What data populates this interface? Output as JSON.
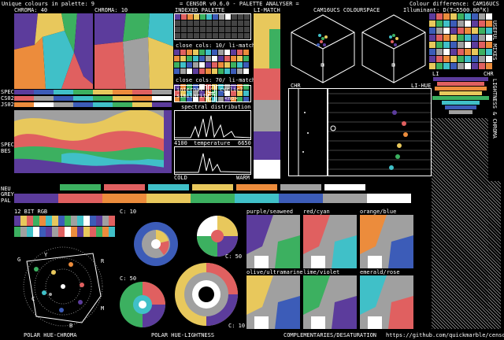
{
  "header": {
    "unique": "Unique colours in palette: 9",
    "title": "= CENSOR v0.6.0 - PALETTE ANALYSER =",
    "colour_diff": "Colour difference: CAM16UCS",
    "illuminant": "Illuminant: D(T=5500.00°K)"
  },
  "labels": {
    "chroma40": "CHROMA: 40",
    "chroma10": "CHROMA: 10",
    "indexed": "INDEXED PALETTE",
    "li_match": "LI-MATCH",
    "cam": "CAM16UCS COLOURSPACE",
    "spec": "SPEC",
    "cs02": "CS02",
    "js02": "JS02",
    "spec2": "SPEC",
    "bes": "BES",
    "neu": "NEU",
    "grey": "GREY",
    "pal": "PAL",
    "bit12": "12 BIT RGB",
    "close1": "close cols: 10/ li-match",
    "close2": "close cols: 70/ li-match",
    "internal": "internal",
    "similarity": "similarity",
    "cyclic": "cyclic?",
    "no": "<no>",
    "spectral": "spectral distribution",
    "k4100": "4100",
    "k6650": "6650",
    "temperature": "temperature",
    "cold": "COLD",
    "warm": "WARM",
    "chr": "CHR",
    "li_hue": "LI-HUE",
    "li": "LI",
    "chr2": "CHR",
    "useful": "USEFUL MIXES",
    "lightness_chroma": "LIGHTNESS & CHROMA",
    "polar_hc": "POLAR HUE-CHROMA",
    "polar_hl": "POLAR HUE-LIGHTNESS",
    "compl": "COMPLEMENTARIES/DESATURATION",
    "url": "https://github.com/quickmarble/censor",
    "c10a": "C: 10",
    "c50a": "C: 50",
    "c50b": "C: 50",
    "c10b": "C: 10",
    "pair1": "purple/seaweed",
    "pair2": "red/cyan",
    "pair3": "orange/blue",
    "pair4": "olive/ultramarine",
    "pair5": "lime/violet",
    "pair6": "emerald/rose",
    "hc_g": "G",
    "hc_y": "Y",
    "hc_r": "R",
    "hc_c": "C",
    "hc_m": "M",
    "hc_b": "B"
  },
  "palette": [
    "#5c3c9c",
    "#e06060",
    "#ec8c3c",
    "#e8c85c",
    "#3cb060",
    "#40c0c8",
    "#3c5cb8",
    "#a0a0a0",
    "#ffffff"
  ],
  "colors": {
    "bg": "#000000",
    "fg": "#ffffff",
    "grid": "#777777"
  }
}
